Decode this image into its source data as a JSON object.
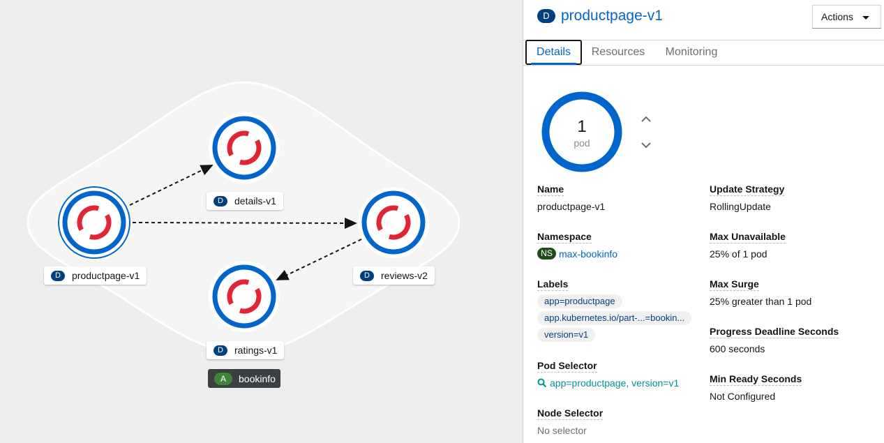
{
  "topology": {
    "nodes": [
      {
        "label": "productpage-v1",
        "kind": "D"
      },
      {
        "label": "details-v1",
        "kind": "D"
      },
      {
        "label": "reviews-v2",
        "kind": "D"
      },
      {
        "label": "ratings-v1",
        "kind": "D"
      }
    ],
    "group": {
      "label": "bookinfo",
      "kind": "A"
    },
    "colors": {
      "ring": "#0066cc",
      "logo": "#e12633",
      "group_badge": "#3e8635",
      "deployment_badge": "#004080"
    }
  },
  "panel": {
    "resource_badge": "D",
    "title": "productpage-v1",
    "actions_label": "Actions",
    "tabs": [
      "Details",
      "Resources",
      "Monitoring"
    ],
    "active_tab": "Details",
    "pod_count": "1",
    "pod_unit": "pod",
    "left": {
      "name_term": "Name",
      "name_value": "productpage-v1",
      "namespace_term": "Namespace",
      "namespace_badge": "NS",
      "namespace_value": "max-bookinfo",
      "labels_term": "Labels",
      "labels": [
        "app=productpage",
        "app.kubernetes.io/part-...=bookin...",
        "version=v1"
      ],
      "pod_selector_term": "Pod Selector",
      "pod_selector_value": "app=productpage, version=v1",
      "node_selector_term": "Node Selector",
      "node_selector_value": "No selector"
    },
    "right": {
      "update_strategy_term": "Update Strategy",
      "update_strategy_value": "RollingUpdate",
      "max_unavailable_term": "Max Unavailable",
      "max_unavailable_value": "25% of 1 pod",
      "max_surge_term": "Max Surge",
      "max_surge_value": "25% greater than 1 pod",
      "progress_deadline_term": "Progress Deadline Seconds",
      "progress_deadline_value": "600 seconds",
      "min_ready_term": "Min Ready Seconds",
      "min_ready_value": "Not Configured"
    }
  }
}
